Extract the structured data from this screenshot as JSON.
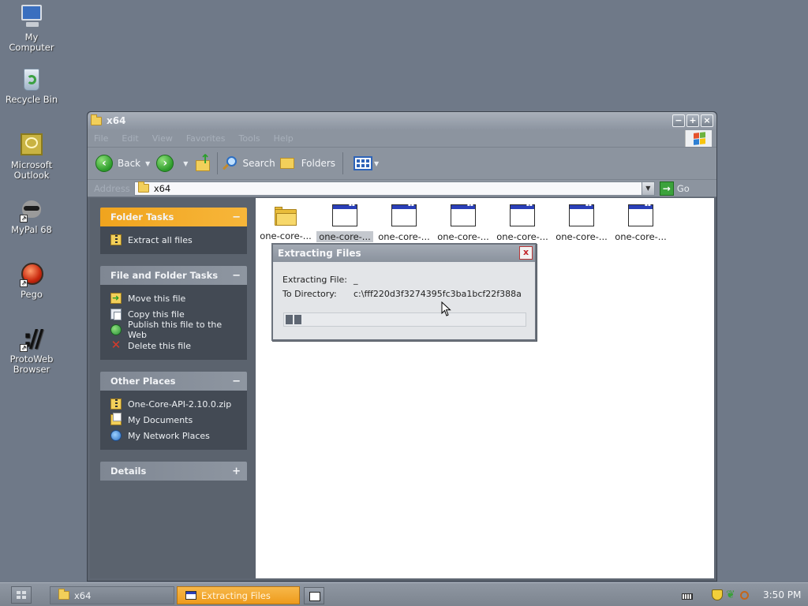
{
  "desktop": {
    "icons": [
      {
        "label_line1": "My",
        "label_line2": "Computer"
      },
      {
        "label_line1": "Recycle Bin",
        "label_line2": ""
      },
      {
        "label_line1": "Microsoft",
        "label_line2": "Outlook"
      },
      {
        "label_line1": "MyPal 68",
        "label_line2": ""
      },
      {
        "label_line1": "Pego",
        "label_line2": ""
      },
      {
        "label_line1": "ProtoWeb",
        "label_line2": "Browser"
      }
    ]
  },
  "explorer": {
    "title": "x64",
    "menu": [
      "File",
      "Edit",
      "View",
      "Favorites",
      "Tools",
      "Help"
    ],
    "toolbar": {
      "back_label": "Back",
      "search_label": "Search",
      "folders_label": "Folders"
    },
    "address": {
      "label": "Address",
      "value": "x64",
      "go_label": "Go"
    },
    "taskpane": {
      "folder_tasks": {
        "title": "Folder Tasks",
        "toggle": "−",
        "items": [
          "Extract all files"
        ]
      },
      "file_folder_tasks": {
        "title": "File and Folder Tasks",
        "toggle": "−",
        "items": [
          "Move this file",
          "Copy this file",
          "Publish this file to the Web",
          "Delete this file"
        ]
      },
      "other_places": {
        "title": "Other Places",
        "toggle": "−",
        "items": [
          "One-Core-API-2.10.0.zip",
          "My Documents",
          "My Network Places"
        ]
      },
      "details": {
        "title": "Details",
        "toggle": "+"
      }
    },
    "files": [
      {
        "label": "one-core-...",
        "type": "folder",
        "selected": false
      },
      {
        "label": "one-core-...",
        "type": "app",
        "selected": true
      },
      {
        "label": "one-core-...",
        "type": "app",
        "selected": false
      },
      {
        "label": "one-core-...",
        "type": "app",
        "selected": false
      },
      {
        "label": "one-core-...",
        "type": "app",
        "selected": false
      },
      {
        "label": "one-core-...",
        "type": "app",
        "selected": false
      },
      {
        "label": "one-core-...",
        "type": "app",
        "selected": false
      }
    ]
  },
  "dialog": {
    "title": "Extracting Files",
    "close": "x",
    "file_label": "Extracting File:",
    "file_value": "_",
    "dir_label": "To Directory:",
    "dir_value": "c:\\fff220d3f3274395fc3ba1bcf22f388a",
    "progress_fraction": 0.08
  },
  "taskbar": {
    "tasks": [
      "x64",
      "Extracting Files"
    ],
    "clock": "3:50 PM"
  },
  "colors": {
    "desktop": "#6f7988",
    "accent_orange": "#f0a41e",
    "panel_body": "#434a54"
  }
}
